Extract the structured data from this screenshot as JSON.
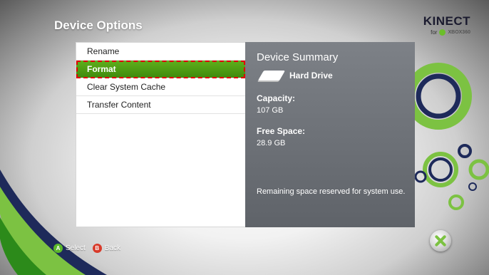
{
  "screen": {
    "title": "Device Options"
  },
  "brand": {
    "word": "KINECT",
    "for": "for",
    "xbox": "XBOX360"
  },
  "menu": {
    "items": [
      {
        "label": "Rename",
        "selected": false
      },
      {
        "label": "Format",
        "selected": true
      },
      {
        "label": "Clear System Cache",
        "selected": false
      },
      {
        "label": "Transfer Content",
        "selected": false
      }
    ]
  },
  "summary": {
    "title": "Device Summary",
    "device": "Hard Drive",
    "capacity_label": "Capacity:",
    "capacity_value": "107 GB",
    "free_label": "Free Space:",
    "free_value": "28.9 GB",
    "note": "Remaining space reserved for system use."
  },
  "footer": {
    "select_glyph": "A",
    "select_label": "Select",
    "back_glyph": "B",
    "back_label": "Back"
  },
  "colors": {
    "selection_green": "#4a9a12",
    "selection_outline": "#e00000",
    "summary_panel": "#6b6f75",
    "swirl_green": "#7cc242",
    "swirl_navy": "#1e2a5a"
  }
}
